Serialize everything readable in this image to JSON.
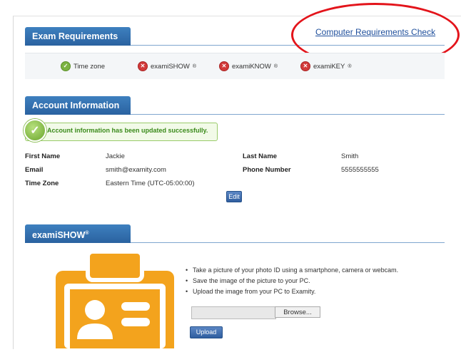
{
  "exam_requirements": {
    "title": "Exam Requirements",
    "link": "Computer Requirements Check",
    "items": [
      {
        "label": "Time zone",
        "status": "ok"
      },
      {
        "label": "examiSHOW",
        "mark": "®",
        "status": "fail"
      },
      {
        "label": "examiKNOW",
        "mark": "®",
        "status": "fail"
      },
      {
        "label": "examiKEY",
        "mark": "®",
        "status": "fail"
      }
    ]
  },
  "account": {
    "title": "Account Information",
    "success_message": "Account information has been updated successfully.",
    "first_name_label": "First Name",
    "first_name": "Jackie",
    "last_name_label": "Last Name",
    "last_name": "Smith",
    "email_label": "Email",
    "email": "smith@examity.com",
    "phone_label": "Phone Number",
    "phone": "5555555555",
    "timezone_label": "Time Zone",
    "timezone": "Eastern Time (UTC-05:00:00)",
    "edit_button": "Edit"
  },
  "examishow": {
    "title": "examiSHOW",
    "mark": "®",
    "steps": [
      "Take a picture of your photo ID using a smartphone, camera or webcam.",
      "Save the image of the picture to your PC.",
      "Upload the image from your PC to Examity."
    ],
    "browse_button": "Browse...",
    "upload_button": "Upload",
    "icon": "id-card-icon"
  },
  "colors": {
    "header_blue": "#2f6fad",
    "annotation_red": "#e3141b",
    "id_orange": "#f3a31d"
  }
}
